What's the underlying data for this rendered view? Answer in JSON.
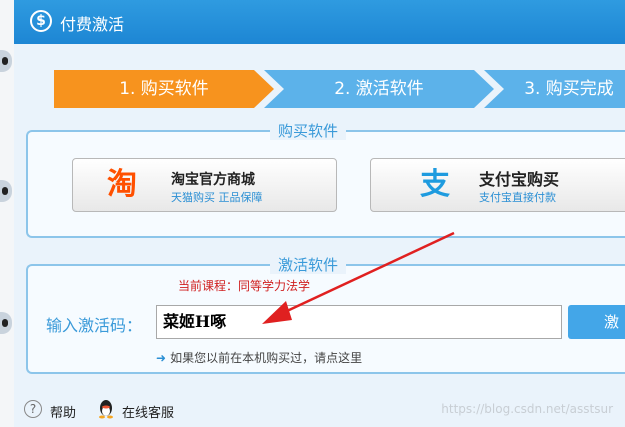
{
  "window": {
    "title": "付费激活",
    "title_icon": "dollar-icon"
  },
  "steps": [
    {
      "label": "1. 购买软件",
      "active": true
    },
    {
      "label": "2. 激活软件",
      "active": false
    },
    {
      "label": "3. 购买完成",
      "active": false
    }
  ],
  "buy_section": {
    "title": "购买软件",
    "taobao": {
      "logo_text": "淘",
      "main": "淘宝官方商城",
      "sub": "天猫购买  正品保障"
    },
    "alipay": {
      "logo_text": "支",
      "main": "支付宝购买",
      "sub": "支付宝直接付款"
    }
  },
  "activate_section": {
    "title": "激活软件",
    "course_label": "当前课程：同等学力法学",
    "code_label": "输入激活码：",
    "code_value": "菜姬H啄",
    "activate_button": "激",
    "hint": "如果您以前在本机购买过，请点这里"
  },
  "footer": {
    "help": "帮助",
    "service": "在线客服",
    "watermark": "https://blog.csdn.net/asstsur"
  },
  "colors": {
    "titlebar": "#1d86d4",
    "step_active": "#f7931e",
    "step_inactive": "#5cb2ea",
    "accent_text": "#3a9ad9",
    "annotation": "#e02020"
  }
}
